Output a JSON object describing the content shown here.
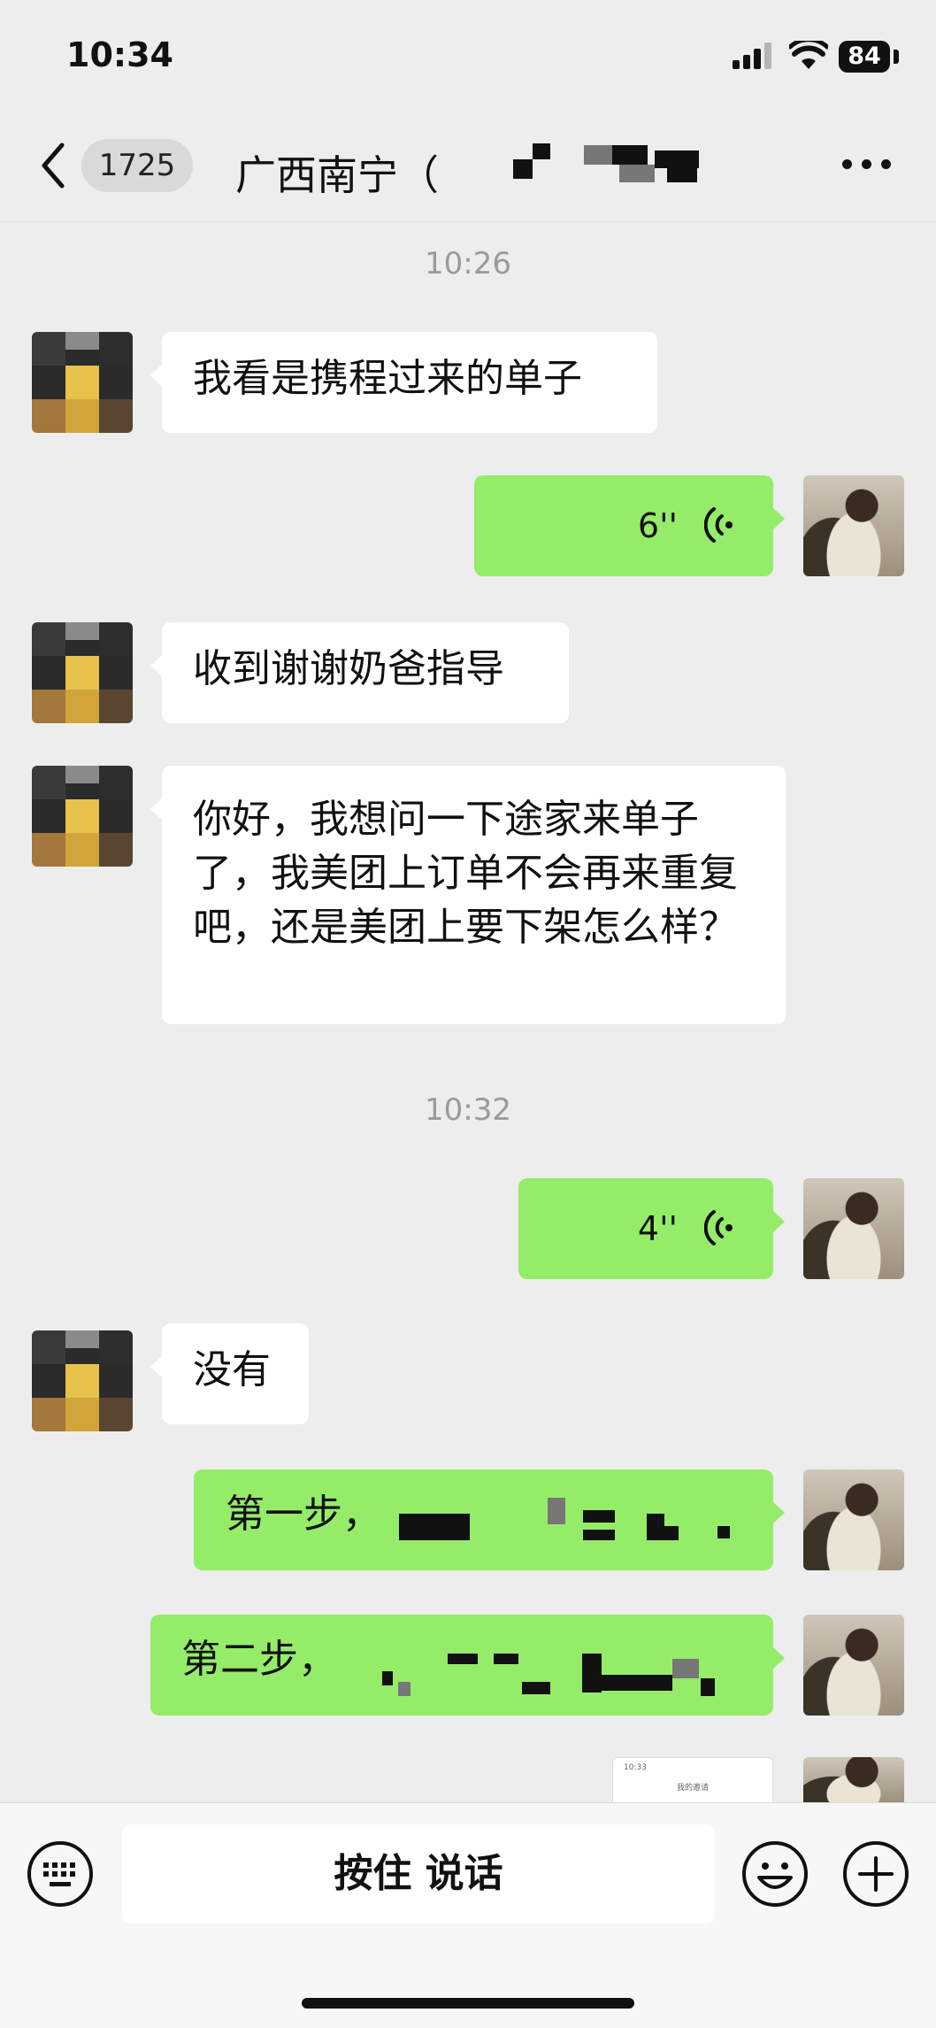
{
  "status": {
    "time": "10:34",
    "battery": "84"
  },
  "nav": {
    "unread_count": "1725",
    "title": "广西南宁（"
  },
  "timestamps": [
    "10:26",
    "10:32"
  ],
  "messages": [
    {
      "type": "text",
      "side": "in",
      "text": "我看是携程过来的单子"
    },
    {
      "type": "voice",
      "side": "out",
      "duration": "6''"
    },
    {
      "type": "text",
      "side": "in",
      "text": "收到谢谢奶爸指导"
    },
    {
      "type": "text",
      "side": "in",
      "text": "你好，我想问一下途家来单子了，我美团上订单不会再来重复吧，还是美团上要下架怎么样？"
    },
    {
      "type": "voice",
      "side": "out",
      "duration": "4''"
    },
    {
      "type": "text",
      "side": "in",
      "text": "没有"
    },
    {
      "type": "text",
      "side": "out",
      "text": "第一步，"
    },
    {
      "type": "text",
      "side": "out",
      "text": "第二步，"
    },
    {
      "type": "image",
      "side": "out",
      "thumb_time": "10:33",
      "thumb_title": "我的邀请"
    }
  ],
  "input": {
    "talk_label": "按住 说话"
  },
  "icons": {
    "back": "chevron-left-icon",
    "more": "more-dots-icon",
    "voice": "voice-wave-icon",
    "keyboard": "keyboard-icon",
    "emoji": "emoji-icon",
    "plus": "plus-icon"
  },
  "colors": {
    "outgoing_bubble": "#95ec69",
    "incoming_bubble": "#ffffff",
    "background": "#ededed"
  }
}
